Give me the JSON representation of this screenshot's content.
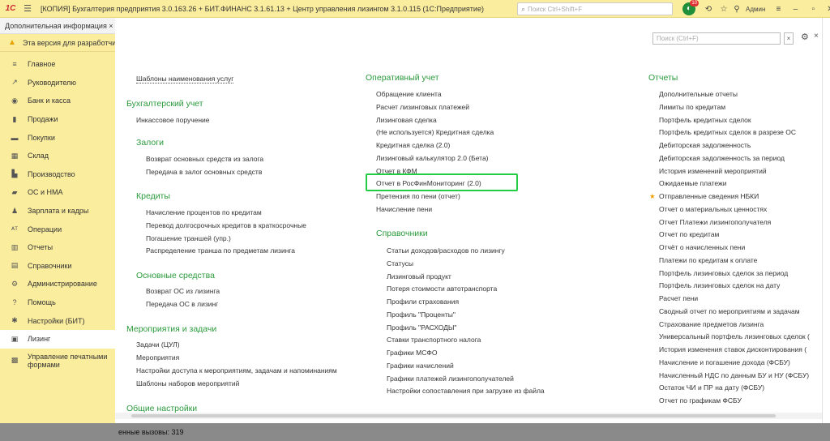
{
  "titlebar": {
    "logo": "1С",
    "app_title": "[КОПИЯ] Бухгалтерия предприятия 3.0.163.26 + БИТ.ФИНАНС 3.1.61.13 + Центр управления лизингом 3.1.0.115 (1С:Предприятие)",
    "search_placeholder": "Поиск Ctrl+Shift+F",
    "notif_count": "10",
    "user": "Админ"
  },
  "breadcrumb": "Дополнительная информация ×",
  "warning": "Эта версия для разработчиков",
  "nav": [
    {
      "label": "Главное",
      "icon": "≡"
    },
    {
      "label": "Руководителю",
      "icon": "↗"
    },
    {
      "label": "Банк и касса",
      "icon": "◉"
    },
    {
      "label": "Продажи",
      "icon": "▮"
    },
    {
      "label": "Покупки",
      "icon": "▬"
    },
    {
      "label": "Склад",
      "icon": "▦"
    },
    {
      "label": "Производство",
      "icon": "▙"
    },
    {
      "label": "ОС и НМА",
      "icon": "▰"
    },
    {
      "label": "Зарплата и кадры",
      "icon": "♟"
    },
    {
      "label": "Операции",
      "icon": "ᴬᵀ"
    },
    {
      "label": "Отчеты",
      "icon": "▥"
    },
    {
      "label": "Справочники",
      "icon": "▤"
    },
    {
      "label": "Администрирование",
      "icon": "⚙"
    },
    {
      "label": "Помощь",
      "icon": "?"
    },
    {
      "label": "Настройки (БИТ)",
      "icon": "✱"
    },
    {
      "label": "Лизинг",
      "icon": "▣"
    },
    {
      "label": "Управление печатными формами",
      "icon": "▩"
    }
  ],
  "content_search": {
    "placeholder": "Поиск (Ctrl+F)",
    "clear": "×"
  },
  "col1": {
    "top_link": "Шаблоны наименования услуг",
    "sections": [
      {
        "title": "Бухгалтерский учет",
        "items": [
          "Инкассовое поручение"
        ]
      },
      {
        "title": "Залоги",
        "items": [
          "Возврат основных средств из залога",
          "Передача в залог основных средств"
        ]
      },
      {
        "title": "Кредиты",
        "items": [
          "Начисление процентов по кредитам",
          "Перевод долгосрочных кредитов в краткосрочные",
          "Погашение траншей (упр.)",
          "Распределение транша по предметам лизинга"
        ]
      },
      {
        "title": "Основные средства",
        "items": [
          "Возврат ОС из лизинга",
          "Передача ОС в лизинг"
        ]
      },
      {
        "title": "Мероприятия и задачи",
        "items": [
          "Задачи (ЦУЛ)",
          "Мероприятия",
          "Настройки доступа к мероприятиям, задачам и напоминаниям",
          "Шаблоны наборов мероприятий"
        ]
      },
      {
        "title": "Общие настройки",
        "items": []
      }
    ]
  },
  "col2": {
    "sections": [
      {
        "title": "Оперативный учет",
        "items": [
          "Обращение клиента",
          "Расчет лизинговых платежей",
          "Лизинговая сделка",
          "(Не используется) Кредитная сделка",
          "Кредитная сделка (2.0)",
          "Лизинговый калькулятор 2.0 (Бета)",
          "Отчет в КФМ",
          "Отчет в РосФинМониторинг (2.0)",
          "Претензия по пени (отчет)",
          "Начисление пени"
        ]
      },
      {
        "title": "Справочники",
        "items": [
          "Статьи доходов/расходов по лизингу",
          "Статусы",
          "Лизинговый продукт",
          "Потеря стоимости автотранспорта",
          "Профили страхования",
          "Профиль \"Проценты\"",
          "Профиль \"РАСХОДЫ\"",
          "Ставки транспортного налога",
          "Графики МСФО",
          "Графики начислений",
          "Графики платежей лизингополучателей",
          "Настройки сопоставления при загрузке из файла"
        ]
      }
    ]
  },
  "col3": {
    "title": "Отчеты",
    "items": [
      "Дополнительные отчеты",
      "Лимиты по кредитам",
      "Портфель кредитных сделок",
      "Портфель кредитных сделок в разрезе ОС",
      "Дебиторская задолженность",
      "Дебиторская задолженность за период",
      "История изменений мероприятий",
      "Ожидаемые платежи",
      "Отправленные сведения НБКИ",
      "Отчет о материальных ценностях",
      "Отчет Платежи лизингополучателя",
      "Отчет по кредитам",
      "Отчёт о начисленных пени",
      "Платежи по кредитам к оплате",
      "Портфель лизинговых сделок за период",
      "Портфель лизинговых сделок на дату",
      "Расчет пени",
      "Сводный отчет по мероприятиям и задачам",
      "Страхование предметов лизинга",
      "Универсальный портфель лизинговых сделок (",
      "История изменения ставок дисконтирования (",
      "Начисление и погашение дохода (ФСБУ)",
      "Начисленный НДС по данным БУ и НУ (ФСБУ)",
      "Остаток ЧИ и ПР на дату (ФСБУ)",
      "Отчет по графикам ФСБУ"
    ],
    "starred_index": 8,
    "star": "★"
  },
  "status": "енные вызовы: 319",
  "colors": {
    "accent_green": "#2a9a3c",
    "panel_yellow": "#fbed9e",
    "highlight": "#22cc44"
  }
}
